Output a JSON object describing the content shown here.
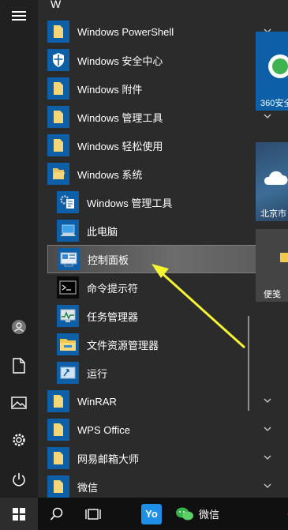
{
  "section_letter": "W",
  "apps": [
    {
      "label": "Windows PowerShell",
      "icon": "folder-icon",
      "chevron": "down"
    },
    {
      "label": "Windows 安全中心",
      "icon": "shield-icon",
      "chevron": ""
    },
    {
      "label": "Windows 附件",
      "icon": "folder-icon",
      "chevron": "down"
    },
    {
      "label": "Windows 管理工具",
      "icon": "folder-icon",
      "chevron": "down"
    },
    {
      "label": "Windows 轻松使用",
      "icon": "folder-icon",
      "chevron": "down"
    },
    {
      "label": "Windows 系统",
      "icon": "folder-open-icon",
      "chevron": "up"
    }
  ],
  "system_items": [
    {
      "label": "Windows 管理工具",
      "icon": "admin-tools-icon"
    },
    {
      "label": "此电脑",
      "icon": "computer-icon"
    },
    {
      "label": "控制面板",
      "icon": "control-panel-icon",
      "selected": true
    },
    {
      "label": "命令提示符",
      "icon": "cmd-icon"
    },
    {
      "label": "任务管理器",
      "icon": "task-manager-icon"
    },
    {
      "label": "文件资源管理器",
      "icon": "file-explorer-icon"
    },
    {
      "label": "运行",
      "icon": "run-icon"
    }
  ],
  "more_apps": [
    {
      "label": "WinRAR",
      "icon": "folder-icon",
      "chevron": "down"
    },
    {
      "label": "WPS Office",
      "icon": "folder-icon",
      "chevron": "down"
    },
    {
      "label": "网易邮箱大师",
      "icon": "folder-icon",
      "chevron": "down"
    },
    {
      "label": "微信",
      "icon": "folder-icon",
      "chevron": "down"
    }
  ],
  "tiles": {
    "security_label": "360安全",
    "weather_label": "北京市",
    "notes_label": "便笺"
  },
  "taskbar": {
    "wechat_label": "微信"
  },
  "colors": {
    "accent": "#0d5fa8",
    "annotation_arrow": "#f5f532",
    "selected_bg": "#5e5e5e"
  }
}
